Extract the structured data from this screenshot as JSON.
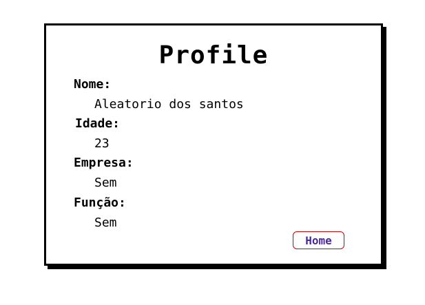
{
  "profile": {
    "title": "Profile",
    "fields": [
      {
        "label": "Nome:",
        "value": "Aleatorio dos santos"
      },
      {
        "label": "Idade:",
        "value": "23"
      },
      {
        "label": "Empresa:",
        "value": "Sem"
      },
      {
        "label": "Função:",
        "value": "Sem"
      }
    ],
    "home_label": "Home"
  },
  "colors": {
    "border": "#000000",
    "home_text": "#4a2a9b",
    "home_border": "#cc0000"
  }
}
